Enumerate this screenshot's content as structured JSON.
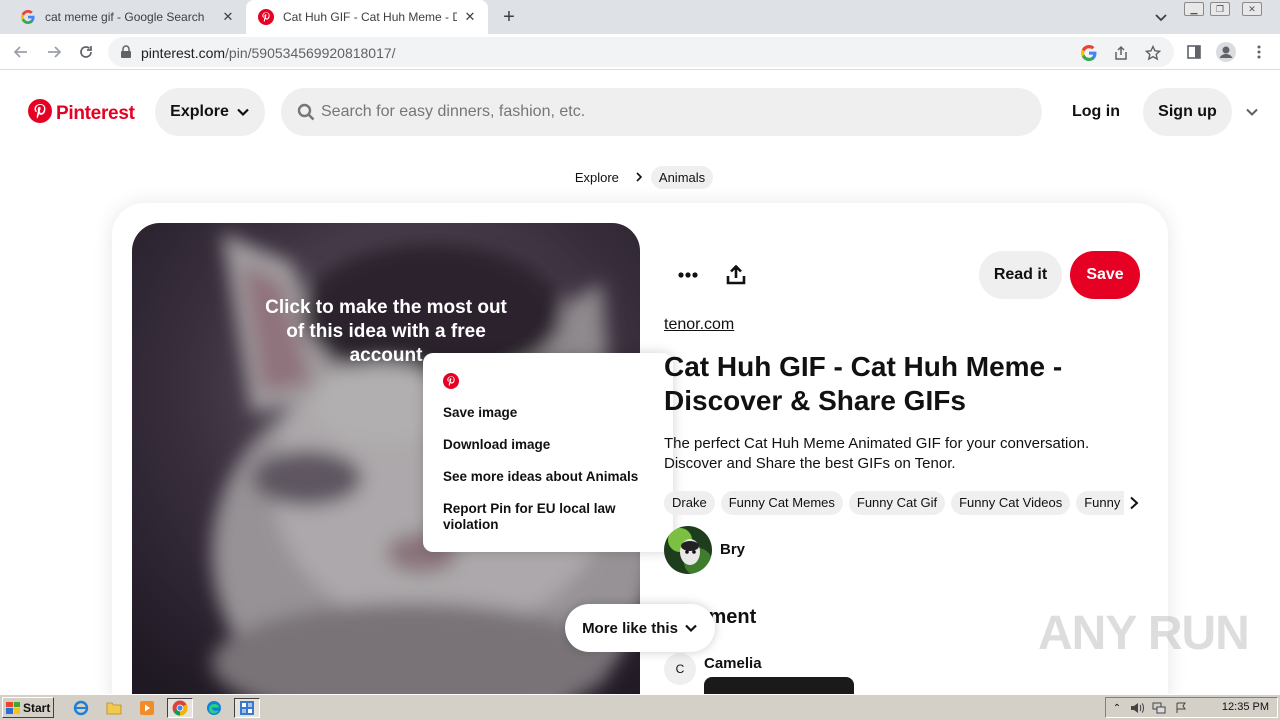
{
  "browser": {
    "tabs": [
      {
        "title": "cat meme gif - Google Search",
        "active": false
      },
      {
        "title": "Cat Huh GIF - Cat Huh Meme - Disco",
        "active": true
      }
    ],
    "new_tab_label": "+",
    "url_host": "pinterest.com",
    "url_path": "/pin/590534569920818017/"
  },
  "header": {
    "logo_text": "Pinterest",
    "explore_label": "Explore",
    "search_placeholder": "Search for easy dinners, fashion, etc.",
    "login_label": "Log in",
    "signup_label": "Sign up"
  },
  "breadcrumb": {
    "items": [
      "Explore",
      "Animals"
    ]
  },
  "pin": {
    "overlay_text": "Click to make the most out of this idea with a free account",
    "source": "tenor.com",
    "title": "Cat Huh GIF - Cat Huh Meme - Discover & Share GIFs",
    "description": "The perfect Cat Huh Meme Animated GIF for your conversation. Discover and Share the best GIFs on Tenor.",
    "read_it_label": "Read it",
    "save_label": "Save",
    "tags": [
      "Drake",
      "Funny Cat Memes",
      "Funny Cat Gif",
      "Funny Cat Videos",
      "Funny Cat Pictures"
    ],
    "author": "Bry",
    "comment_heading": "Comment",
    "commenter_initial": "C",
    "commenter_name": "Camelia",
    "more_like_this": "More like this"
  },
  "context_menu": {
    "items": [
      "Save image",
      "Download image",
      "See more ideas about Animals",
      "Report Pin for EU local law violation"
    ]
  },
  "watermark": "ANY RUN",
  "taskbar": {
    "start_label": "Start",
    "clock": "12:35 PM"
  },
  "colors": {
    "brand": "#e60023",
    "pill_bg": "#efefef"
  }
}
